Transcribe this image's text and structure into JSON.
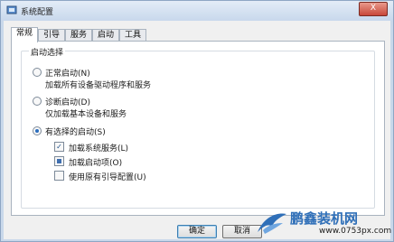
{
  "window": {
    "title": "系统配置",
    "close_label": "X"
  },
  "tabs": [
    {
      "label": "常规",
      "active": true
    },
    {
      "label": "引导",
      "active": false
    },
    {
      "label": "服务",
      "active": false
    },
    {
      "label": "启动",
      "active": false
    },
    {
      "label": "工具",
      "active": false
    }
  ],
  "startup_selection": {
    "legend": "启动选择",
    "options": [
      {
        "label": "正常启动(N)",
        "description": "加载所有设备驱动程序和服务",
        "selected": false
      },
      {
        "label": "诊断启动(D)",
        "description": "仅加载基本设备和服务",
        "selected": false
      },
      {
        "label": "有选择的启动(S)",
        "selected": true
      }
    ],
    "checkboxes": [
      {
        "label": "加载系统服务(L)",
        "state": "checked"
      },
      {
        "label": "加载启动项(O)",
        "state": "indeterminate"
      },
      {
        "label": "使用原有引导配置(U)",
        "state": "unchecked"
      }
    ]
  },
  "buttons": {
    "ok": "确定",
    "cancel": "取消"
  },
  "watermark": {
    "main": "鹏鑫装机网",
    "url": "www.0753px.com"
  }
}
